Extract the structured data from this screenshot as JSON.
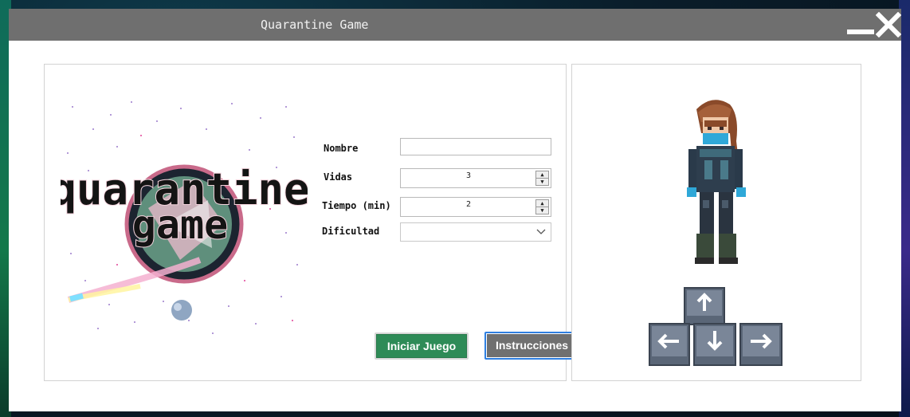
{
  "window": {
    "title": "Quarantine Game"
  },
  "logo": {
    "text_line1": "quarantine",
    "text_line2": "game"
  },
  "form": {
    "nombre_label": "Nombre",
    "nombre_value": "",
    "vidas_label": "Vidas",
    "vidas_value": "3",
    "tiempo_label": "Tiempo (min)",
    "tiempo_value": "2",
    "dificultad_label": "Dificultad",
    "dificultad_value": ""
  },
  "buttons": {
    "start": "Iniciar Juego",
    "instructions": "Instrucciones"
  },
  "icons": {
    "minimize": "minimize-icon",
    "close": "close-icon",
    "spin_up": "▲",
    "spin_down": "▼",
    "arrow_up": "arrow-up-key-icon",
    "arrow_left": "arrow-left-key-icon",
    "arrow_down": "arrow-down-key-icon",
    "arrow_right": "arrow-right-key-icon"
  },
  "colors": {
    "titlebar": "#6f6f6f",
    "start_button": "#2e8b57",
    "instructions_button": "#707070",
    "focus_border": "#2f7fe0"
  }
}
